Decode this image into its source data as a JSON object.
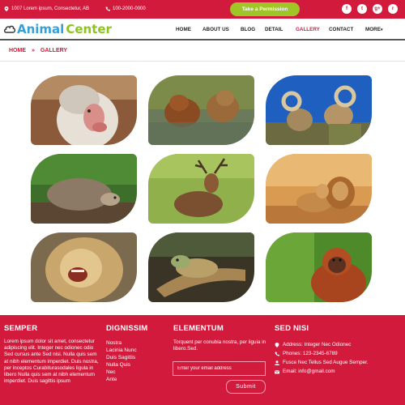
{
  "topbar": {
    "address": "1007 Lorem ipsum, Consectetur, AB",
    "phone": "100-2000-0000",
    "permission_button": "Take a Permission",
    "socials": [
      {
        "icon": "facebook-icon",
        "glyph": "f"
      },
      {
        "icon": "twitter-icon",
        "glyph": "t"
      },
      {
        "icon": "google-plus-icon",
        "glyph": "g+"
      },
      {
        "icon": "rss-icon",
        "glyph": "r"
      }
    ]
  },
  "header": {
    "logo_part1": "Animal",
    "logo_part2": "Center",
    "nav": [
      "HOME",
      "ABOUT US",
      "BLOG",
      "DETAIL",
      "GALLERY",
      "CONTACT",
      "MORE"
    ],
    "active": "GALLERY"
  },
  "breadcrumb": {
    "home": "HOME",
    "separator": "»",
    "current": "GALLERY"
  },
  "gallery": {
    "images": [
      {
        "subject": "baboon"
      },
      {
        "subject": "bears"
      },
      {
        "subject": "rams"
      },
      {
        "subject": "hedgehog"
      },
      {
        "subject": "deer"
      },
      {
        "subject": "lions"
      },
      {
        "subject": "roaring-lion"
      },
      {
        "subject": "iguana"
      },
      {
        "subject": "orangutan"
      }
    ]
  },
  "footer": {
    "col1": {
      "title": "SEMPER",
      "text": "Lorem ipsum dolor sit amet, consectetur adipiscing elit. Integer nec odionec odio Sed cursus ante Sed nisi. Nulla quis sem at nibh elementum imperdiet. Duis nostra, per inceptos Curabiturasodales ligula in libero Nulla quis sem at nibh elementum imperdiet. Duis sagittis ipsum"
    },
    "col2": {
      "title": "DIGNISSIM",
      "links": [
        "Nostra",
        "Lacinia Nunc",
        "Duis Sagittis",
        "Nulla Quis",
        "Nec",
        "Ante"
      ]
    },
    "col3": {
      "title": "ELEMENTUM",
      "text": "Torquent per conubia nostra, per liguia in libero.Sed.",
      "email_placeholder": "Enter your email address",
      "submit": "Submit"
    },
    "col4": {
      "title": "SED NISI",
      "address": "Address: Integer Nec Odionec",
      "phone": "Phones: 123-2345-6789",
      "fax": "Fusce Nec Tellus Sed Augue Semper.",
      "email": "Email: info@gmail.com"
    }
  },
  "colors": {
    "brand_red": "#d21a3c",
    "accent_green": "#9fc526",
    "logo_blue": "#36a0d6"
  }
}
